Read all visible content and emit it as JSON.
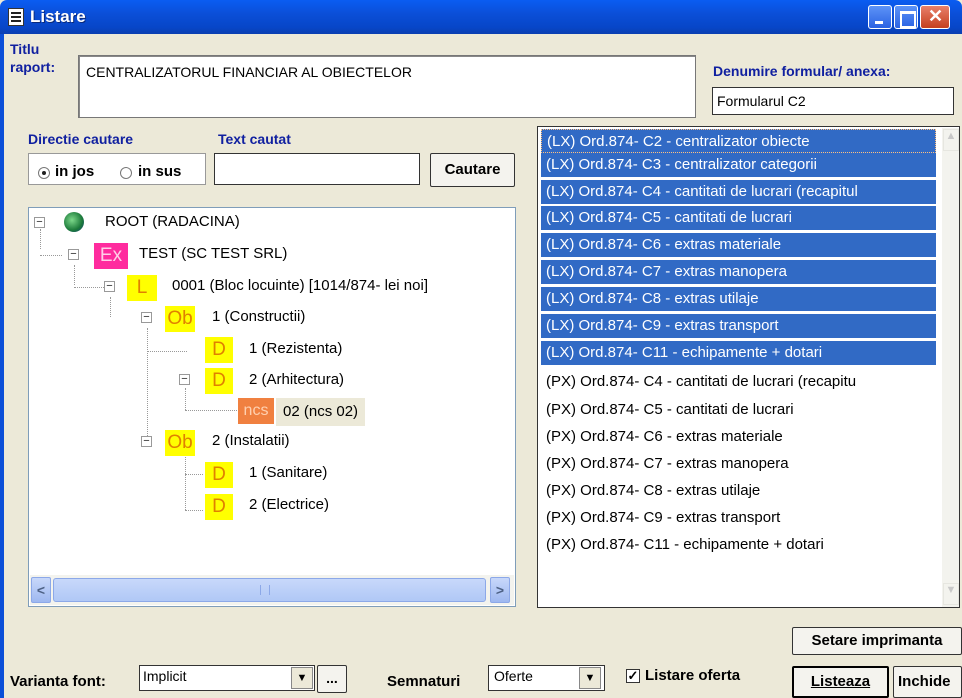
{
  "window": {
    "title": "Listare"
  },
  "report": {
    "title_label": "Titlu raport:",
    "title_value": "CENTRALIZATORUL FINANCIAR AL OBIECTELOR",
    "form_label": "Denumire formular/ anexa:",
    "form_value": "Formularul C2"
  },
  "search": {
    "direction_label": "Directie cautare",
    "text_label": "Text cautat",
    "option_down": "in jos",
    "option_up": "in sus",
    "selected": "in jos",
    "input_value": "",
    "button_label": "Cautare"
  },
  "tree": [
    {
      "icon": "globe-icon",
      "label": "ROOT (RADACINA)"
    },
    {
      "icon_text": "Ex",
      "label": "TEST (SC TEST SRL)"
    },
    {
      "icon_text": "L",
      "label": "0001 (Bloc locuinte) [1014/874- lei noi]"
    },
    {
      "icon_text": "Ob",
      "label": "1 (Constructii)"
    },
    {
      "icon_text": "D",
      "label": "1 (Rezistenta)"
    },
    {
      "icon_text": "D",
      "label": "2 (Arhitectura)"
    },
    {
      "icon_text": "ncs",
      "label": "02 (ncs 02)",
      "selected": true
    },
    {
      "icon_text": "Ob",
      "label": "2 (Instalatii)"
    },
    {
      "icon_text": "D",
      "label": "1 (Sanitare)"
    },
    {
      "icon_text": "D",
      "label": "2 (Electrice)"
    }
  ],
  "reports": [
    {
      "label": "(LX) Ord.874- C2 - centralizator obiecte",
      "selected": true
    },
    {
      "label": "(LX) Ord.874- C3 - centralizator categorii",
      "selected": true
    },
    {
      "label": "(LX) Ord.874- C4 - cantitati de lucrari (recapitul",
      "selected": true
    },
    {
      "label": "(LX) Ord.874- C5 - cantitati de lucrari",
      "selected": true
    },
    {
      "label": "(LX) Ord.874- C6 - extras materiale",
      "selected": true
    },
    {
      "label": "(LX) Ord.874- C7 - extras manopera",
      "selected": true
    },
    {
      "label": "(LX) Ord.874- C8 - extras utilaje",
      "selected": true
    },
    {
      "label": "(LX) Ord.874- C9 - extras transport",
      "selected": true
    },
    {
      "label": "(LX) Ord.874- C11 - echipamente + dotari",
      "selected": true
    },
    {
      "label": "(PX) Ord.874- C4 - cantitati de lucrari (recapitu",
      "selected": false
    },
    {
      "label": "(PX) Ord.874- C5 - cantitati de lucrari",
      "selected": false
    },
    {
      "label": "(PX) Ord.874- C6 - extras materiale",
      "selected": false
    },
    {
      "label": "(PX) Ord.874- C7 - extras manopera",
      "selected": false
    },
    {
      "label": "(PX) Ord.874- C8 - extras utilaje",
      "selected": false
    },
    {
      "label": "(PX) Ord.874- C9 - extras transport",
      "selected": false
    },
    {
      "label": "(PX) Ord.874- C11 - echipamente + dotari",
      "selected": false
    }
  ],
  "bottom": {
    "printer_button": "Setare imprimanta",
    "font_label": "Varianta font:",
    "font_value": "Implicit",
    "dots_button": "...",
    "signatures_label": "Semnaturi",
    "signatures_value": "Oferte",
    "offer_checkbox_label": "Listare oferta",
    "offer_checked": true,
    "list_button": "Listeaza",
    "close_button": "Inchide"
  },
  "colors": {
    "selection": "#316AC5",
    "label_blue": "#1020A0",
    "titlebar": "#0B4FD8"
  }
}
